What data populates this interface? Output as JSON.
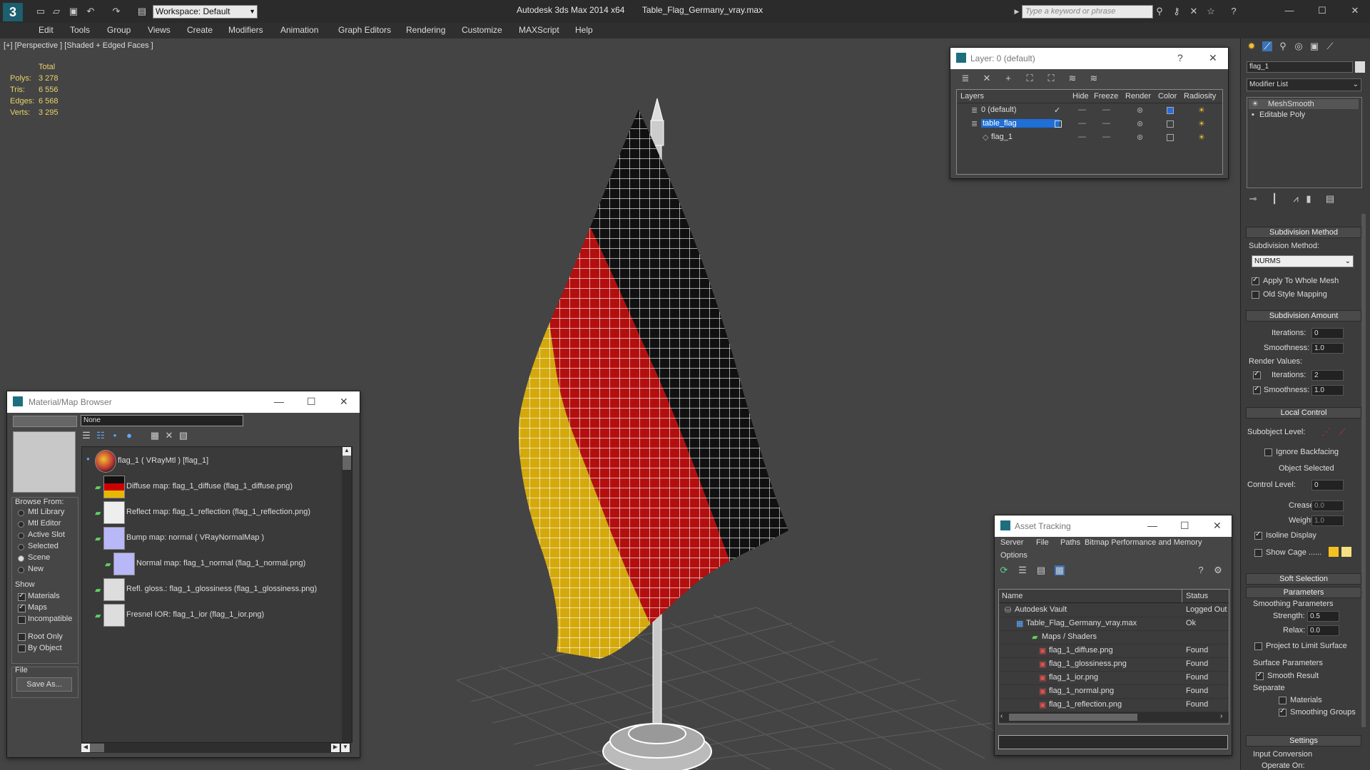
{
  "app": {
    "title": "Autodesk 3ds Max  2014 x64",
    "file": "Table_Flag_Germany_vray.max",
    "workspace": "Workspace: Default",
    "search_placeholder": "Type a keyword or phrase"
  },
  "menu": [
    "Edit",
    "Tools",
    "Group",
    "Views",
    "Create",
    "Modifiers",
    "Animation",
    "Graph Editors",
    "Rendering",
    "Customize",
    "MAXScript",
    "Help"
  ],
  "viewport": {
    "label": "[+] [Perspective ] [Shaded + Edged Faces ]",
    "stats": {
      "header": "Total",
      "rows": [
        {
          "k": "Polys:",
          "v": "3 278"
        },
        {
          "k": "Tris:",
          "v": "6 556"
        },
        {
          "k": "Edges:",
          "v": "6 568"
        },
        {
          "k": "Verts:",
          "v": "3 295"
        }
      ]
    },
    "flag_colors": [
      "#111111",
      "#b30f0f",
      "#d4a90c"
    ]
  },
  "layer": {
    "title": "Layer: 0 (default)",
    "help": "?",
    "cols": [
      "Layers",
      "Hide",
      "Freeze",
      "Render",
      "Color",
      "Radiosity"
    ],
    "rows": [
      {
        "name": "0 (default)",
        "check": "✓"
      },
      {
        "name": "table_flag"
      },
      {
        "name": "flag_1"
      }
    ]
  },
  "material": {
    "title": "Material/Map Browser",
    "filter": "None",
    "browse_from": "Browse From:",
    "browse_options": [
      "Mtl Library",
      "Mtl Editor",
      "Active Slot",
      "Selected",
      "Scene",
      "New"
    ],
    "show": "Show",
    "show_options": [
      {
        "label": "Materials",
        "on": true
      },
      {
        "label": "Maps",
        "on": true
      },
      {
        "label": "Incompatible",
        "on": false
      }
    ],
    "root_only": "Root Only",
    "by_object": "By Object",
    "file": "File",
    "save_as": "Save As...",
    "items": [
      "flag_1  ( VRayMtl )  [flag_1]",
      "Diffuse map: flag_1_diffuse (flag_1_diffuse.png)",
      "Reflect map: flag_1_reflection (flag_1_reflection.png)",
      "Bump map: normal  ( VRayNormalMap )",
      "Normal map: flag_1_normal (flag_1_normal.png)",
      "Refl. gloss.: flag_1_glossiness (flag_1_glossiness.png)",
      "Fresnel IOR: flag_1_ior (flag_1_ior.png)"
    ]
  },
  "asset": {
    "title": "Asset Tracking",
    "menu": [
      "Server",
      "File",
      "Paths",
      "Bitmap Performance and Memory",
      "Options"
    ],
    "cols": [
      "Name",
      "Status"
    ],
    "rows": [
      {
        "name": "Autodesk Vault",
        "status": "Logged Out"
      },
      {
        "name": "Table_Flag_Germany_vray.max",
        "status": "Ok"
      },
      {
        "name": "Maps / Shaders",
        "status": ""
      },
      {
        "name": "flag_1_diffuse.png",
        "status": "Found"
      },
      {
        "name": "flag_1_glossiness.png",
        "status": "Found"
      },
      {
        "name": "flag_1_ior.png",
        "status": "Found"
      },
      {
        "name": "flag_1_normal.png",
        "status": "Found"
      },
      {
        "name": "flag_1_reflection.png",
        "status": "Found"
      }
    ]
  },
  "cmd": {
    "object_name": "flag_1",
    "modifier_list": "Modifier List",
    "stack": [
      "MeshSmooth",
      "Editable Poly"
    ],
    "subdivision_method": "Subdivision Method",
    "subdivision_method_label": "Subdivision Method:",
    "method_value": "NURMS",
    "apply_whole": "Apply To Whole Mesh",
    "old_style": "Old Style Mapping",
    "subdivision_amount": "Subdivision Amount",
    "iterations": "Iterations:",
    "iterations_val": "0",
    "smoothness": "Smoothness:",
    "smoothness_val": "1.0",
    "render_values": "Render Values:",
    "r_iterations_val": "2",
    "r_smoothness_val": "1.0",
    "local_control": "Local Control",
    "subobject_level": "Subobject Level:",
    "ignore_backfacing": "Ignore Backfacing",
    "object_selected": "Object Selected",
    "control_level": "Control Level:",
    "control_level_val": "0",
    "crease": "Crease:",
    "crease_val": "0.0",
    "weight": "Weight:",
    "weight_val": "1.0",
    "isoline": "Isoline Display",
    "show_cage": "Show Cage ......",
    "soft_selection": "Soft Selection",
    "parameters": "Parameters",
    "smoothing_params": "Smoothing Parameters",
    "strength": "Strength:",
    "strength_val": "0.5",
    "relax": "Relax:",
    "relax_val": "0.0",
    "project_limit": "Project to Limit Surface",
    "surface_params": "Surface Parameters",
    "smooth_result": "Smooth Result",
    "separate": "Separate",
    "materials": "Materials",
    "smoothing_groups": "Smoothing Groups",
    "settings": "Settings",
    "input_conversion": "Input Conversion",
    "operate_on": "Operate On:"
  }
}
